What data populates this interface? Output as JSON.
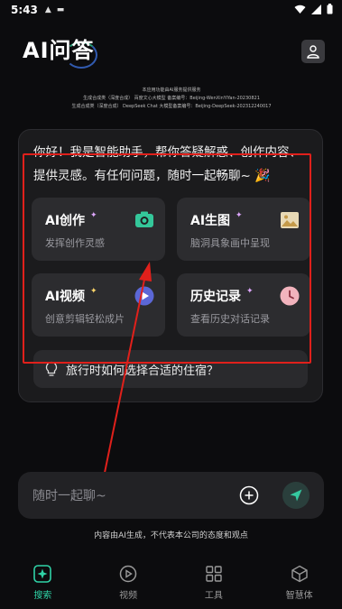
{
  "status": {
    "time": "5:43",
    "icons": [
      "a-icon",
      "ticket-icon"
    ],
    "right_icons": [
      "wifi-icon",
      "signal-icon",
      "battery-icon"
    ]
  },
  "header": {
    "title": "AI问答"
  },
  "registration": {
    "line1": "本应用功能由AI服务提供服务",
    "line2": "生成合成类（深度合成）   百度文心大模型 备案编号：Beijing-WenXinYiYan-20230821",
    "line3": "生成合成类（深度合成）   DeepSeek Chat 大模型备案编号：Beijing-DeepSeek-202312240017"
  },
  "greeting": {
    "text": "你好！我是智能助手，帮你答疑解惑、创作内容、提供灵感。有任何问题，随时一起畅聊~",
    "emoji": "🎉"
  },
  "features": [
    {
      "title": "AI创作",
      "subtitle": "发挥创作灵感",
      "icon": "camera-icon"
    },
    {
      "title": "AI生图",
      "subtitle": "脑洞具象画中呈现",
      "icon": "image-icon"
    },
    {
      "title": "AI视频",
      "subtitle": "创意剪辑轻松成片",
      "icon": "play-icon"
    },
    {
      "title": "历史记录",
      "subtitle": "查看历史对话记录",
      "icon": "clock-icon"
    }
  ],
  "suggestion": {
    "text": "旅行时如何选择合适的住宿？",
    "icon": "lightbulb-icon"
  },
  "input": {
    "placeholder": "随时一起聊~"
  },
  "disclaimer": "内容由AI生成，不代表本公司的态度和观点",
  "tabs": [
    {
      "label": "搜索",
      "icon": "sparkle-icon",
      "active": true
    },
    {
      "label": "视频",
      "icon": "play-circle-icon",
      "active": false
    },
    {
      "label": "工具",
      "icon": "grid-icon",
      "active": false
    },
    {
      "label": "智慧体",
      "icon": "cube-icon",
      "active": false
    }
  ],
  "colors": {
    "background": "#0c0c0e",
    "card": "#1b1b1d",
    "tile": "#2c2c2f",
    "accent": "#2fd3a7",
    "annotation_red": "#e0201b"
  }
}
